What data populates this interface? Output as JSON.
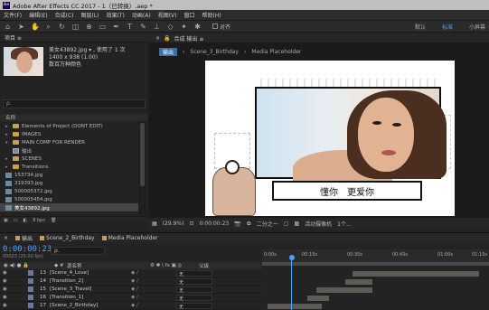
{
  "titlebar": {
    "logo": "Ae",
    "title": "Adobe After Effects CC 2017 - 1（已转换）.aep *"
  },
  "menu": [
    "文件(F)",
    "编辑(E)",
    "合成(C)",
    "图层(L)",
    "效果(T)",
    "动画(A)",
    "视图(V)",
    "窗口",
    "帮助(H)"
  ],
  "toolbar": {
    "snap_label": "对齐",
    "workspaces": [
      "默认",
      "标准",
      "小屏幕"
    ],
    "active_workspace": "标准"
  },
  "project": {
    "header": "项目 ≡",
    "selected_name": "美女43892.jpg ▾ , 使用了 1 次",
    "dims": "1400 x 938 (1.00)",
    "color": "数百万种颜色",
    "search_placeholder": "ρ.",
    "col_name": "名称",
    "items": [
      {
        "type": "folder",
        "label": "Elements of Project (DONT EDIT)",
        "indent": 0
      },
      {
        "type": "folder",
        "label": "IMAGES",
        "indent": 0
      },
      {
        "type": "folder",
        "label": "MAIN COMP FOR RENDER",
        "indent": 0,
        "open": true
      },
      {
        "type": "comp",
        "label": "输出",
        "indent": 1
      },
      {
        "type": "folder",
        "label": "SCENES",
        "indent": 0
      },
      {
        "type": "folder",
        "label": "Transitions",
        "indent": 0
      },
      {
        "type": "img",
        "label": "153734.jpg",
        "indent": 0
      },
      {
        "type": "img",
        "label": "319393.jpg",
        "indent": 0
      },
      {
        "type": "img",
        "label": "500005372.jpg",
        "indent": 0
      },
      {
        "type": "img",
        "label": "500005454.jpg",
        "indent": 0
      },
      {
        "type": "img",
        "label": "美女43892.jpg",
        "indent": 0,
        "selected": true
      }
    ],
    "footer": "8 bpc"
  },
  "viewer": {
    "header": "合成 输出 ≡",
    "breadcrumbs": [
      "输出",
      "Scene_3_Birthday",
      "Media Placeholder"
    ],
    "caption": "懂你　更爱你",
    "zoom": "(29.9%)",
    "timecode": "0:00:00:23",
    "quality": "二分之一",
    "camera": "活动摄像机",
    "views": "1个..."
  },
  "timeline": {
    "tabs": [
      "输出",
      "Scene_2_Birthday",
      "Media Placeholder"
    ],
    "timecode": "0:00:00:23",
    "tc_sub": "00023 (25.00 fps)",
    "search_placeholder": "ρ.",
    "col_source": "源名称",
    "col_parent": "父级",
    "ticks": [
      "0:00s",
      "00:15s",
      "00:30s",
      "00:45s",
      "01:00s",
      "01:15s"
    ],
    "layers": [
      {
        "num": "13",
        "name": "[Scene_4_Love]",
        "parent": "无"
      },
      {
        "num": "14",
        "name": "[Transition_2]",
        "parent": "无"
      },
      {
        "num": "15",
        "name": "[Scene_3_Travel]",
        "parent": "无"
      },
      {
        "num": "16",
        "name": "[Transition_1]",
        "parent": "无"
      },
      {
        "num": "17",
        "name": "[Scene_2_Birthday]",
        "parent": "无"
      }
    ]
  },
  "colors": {
    "accent": "#4aa3ff",
    "folder": "#c9a04d",
    "selection": "#3e6ea8"
  }
}
